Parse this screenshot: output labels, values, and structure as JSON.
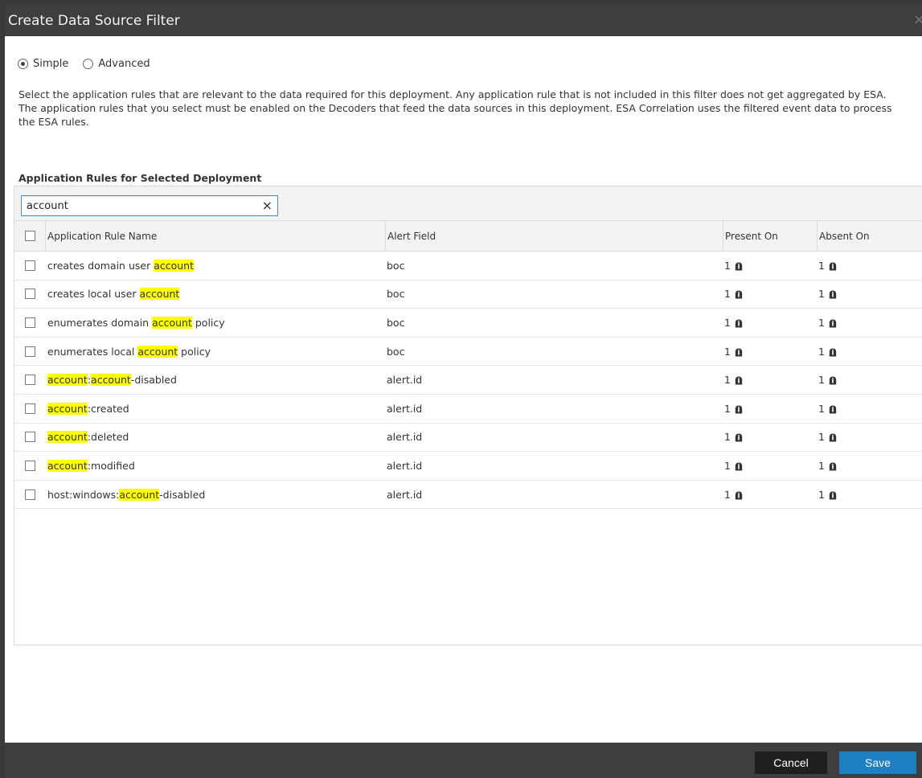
{
  "dialog": {
    "title": "Create Data Source Filter",
    "close_icon": "×"
  },
  "mode": {
    "options": [
      {
        "label": "Simple",
        "checked": true
      },
      {
        "label": "Advanced",
        "checked": false
      }
    ]
  },
  "description": {
    "p1": "Select the application rules that are relevant to the data required for this deployment. Any application rule that is not included in this filter does not get aggregated by ESA.",
    "p2": "The application rules that you select must be enabled on the Decoders that feed the data sources in this deployment. ESA Correlation uses the filtered event data to process the ESA rules."
  },
  "section_title": "Application Rules for Selected Deployment",
  "search": {
    "value": "account",
    "clear_icon": "×"
  },
  "table": {
    "headers": {
      "name": "Application Rule Name",
      "alert_field": "Alert Field",
      "present_on": "Present On",
      "absent_on": "Absent On"
    },
    "rows": [
      {
        "parts": [
          "creates domain user ",
          "account",
          ""
        ],
        "alert_field": "boc",
        "present_on": "1",
        "absent_on": "1"
      },
      {
        "parts": [
          "creates local user ",
          "account",
          ""
        ],
        "alert_field": "boc",
        "present_on": "1",
        "absent_on": "1"
      },
      {
        "parts": [
          "enumerates domain ",
          "account",
          " policy"
        ],
        "alert_field": "boc",
        "present_on": "1",
        "absent_on": "1"
      },
      {
        "parts": [
          "enumerates local ",
          "account",
          " policy"
        ],
        "alert_field": "boc",
        "present_on": "1",
        "absent_on": "1"
      },
      {
        "parts": [
          "",
          "account",
          ":",
          "account",
          "-disabled"
        ],
        "alert_field": "alert.id",
        "present_on": "1",
        "absent_on": "1"
      },
      {
        "parts": [
          "",
          "account",
          ":created"
        ],
        "alert_field": "alert.id",
        "present_on": "1",
        "absent_on": "1"
      },
      {
        "parts": [
          "",
          "account",
          ":deleted"
        ],
        "alert_field": "alert.id",
        "present_on": "1",
        "absent_on": "1"
      },
      {
        "parts": [
          "",
          "account",
          ":modified"
        ],
        "alert_field": "alert.id",
        "present_on": "1",
        "absent_on": "1"
      },
      {
        "parts": [
          "host:windows:",
          "account",
          "-disabled"
        ],
        "alert_field": "alert.id",
        "present_on": "1",
        "absent_on": "1"
      }
    ]
  },
  "footer": {
    "cancel_label": "Cancel",
    "save_label": "Save"
  },
  "colors": {
    "highlight": "#ffff00",
    "save": "#1e7fc2",
    "titlebar": "#3e3e3e"
  }
}
